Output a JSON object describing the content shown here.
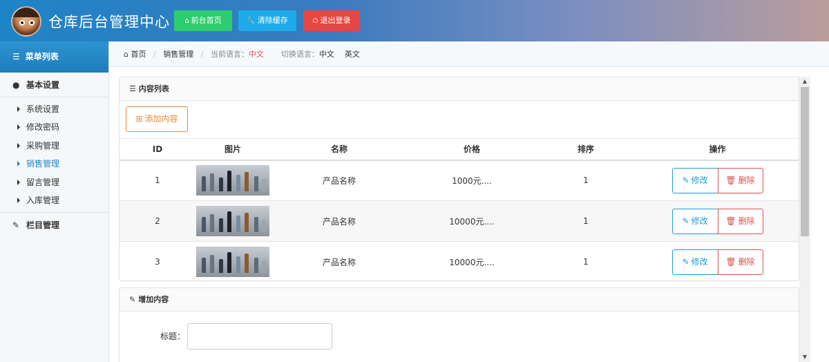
{
  "header": {
    "site_title": "仓库后台管理中心",
    "buttons": [
      {
        "label": "前台首页",
        "icon": "home-icon",
        "color": "#2ecc71"
      },
      {
        "label": "清除缓存",
        "icon": "wrench-icon",
        "color": "#1cabe8"
      },
      {
        "label": "退出登录",
        "icon": "power-icon",
        "color": "#e84545"
      }
    ]
  },
  "sidebar": {
    "title": "菜单列表",
    "group_basic": "基本设置",
    "items": [
      {
        "label": "系统设置"
      },
      {
        "label": "修改密码"
      },
      {
        "label": "采购管理"
      },
      {
        "label": "销售管理",
        "active": true
      },
      {
        "label": "留言管理"
      },
      {
        "label": "入库管理"
      }
    ],
    "group_column": "栏目管理"
  },
  "breadcrumb": {
    "home": "首页",
    "current": "销售管理",
    "lang_label": "当前语言：",
    "lang_value": "中文",
    "switch_label": "切换语言：",
    "switch_zh": "中文",
    "switch_en": "英文"
  },
  "list_panel": {
    "title": "内容列表",
    "add_button": "添加内容",
    "columns": [
      "ID",
      "图片",
      "名称",
      "价格",
      "排序",
      "操作"
    ],
    "rows": [
      {
        "id": "1",
        "name": "产品名称",
        "price": "1000元....",
        "sort": "1"
      },
      {
        "id": "2",
        "name": "产品名称",
        "price": "10000元....",
        "sort": "1"
      },
      {
        "id": "3",
        "name": "产品名称",
        "price": "10000元....",
        "sort": "1"
      }
    ],
    "edit_label": "修改",
    "delete_label": "删除"
  },
  "add_panel": {
    "title": "增加内容",
    "field_title_label": "标题：",
    "field_title_value": ""
  },
  "colors": {
    "accent": "#1e88c8",
    "edit": "#1e9bd8",
    "delete": "#d9534f",
    "add": "#e8883a"
  }
}
